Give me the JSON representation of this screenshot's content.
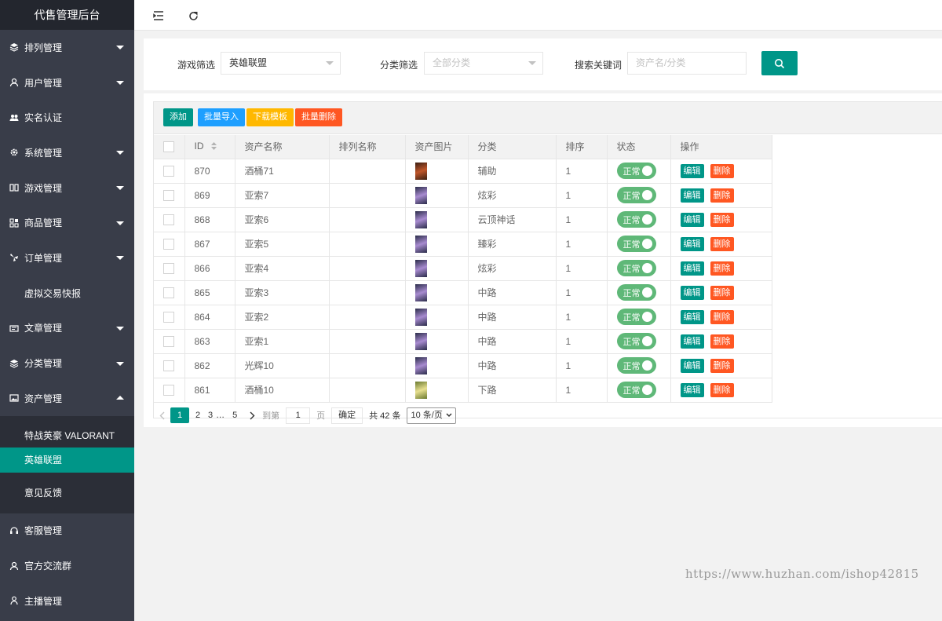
{
  "app": {
    "title": "代售管理后台"
  },
  "sidebar": {
    "items": [
      {
        "label": "排列管理",
        "icon": "layers-icon"
      },
      {
        "label": "用户管理",
        "icon": "user-icon"
      },
      {
        "label": "实名认证",
        "icon": "users-icon"
      },
      {
        "label": "系统管理",
        "icon": "gear-icon"
      },
      {
        "label": "游戏管理",
        "icon": "columns-icon"
      },
      {
        "label": "商品管理",
        "icon": "grid-icon"
      },
      {
        "label": "订单管理",
        "icon": "fan-icon"
      },
      {
        "label": "虚拟交易快报",
        "icon": ""
      },
      {
        "label": "文章管理",
        "icon": "article-icon"
      },
      {
        "label": "分类管理",
        "icon": "layers-icon"
      },
      {
        "label": "资产管理",
        "icon": "image-icon"
      }
    ],
    "asset_sub": [
      {
        "label": "特战英豪 VALORANT"
      },
      {
        "label": "英雄联盟"
      },
      {
        "label": "意见反馈"
      }
    ],
    "bottom_items": [
      {
        "label": "客服管理",
        "icon": "headset-icon"
      },
      {
        "label": "官方交流群",
        "icon": "user-icon"
      },
      {
        "label": "主播管理",
        "icon": "person-icon"
      }
    ]
  },
  "filters": {
    "game_label": "游戏筛选",
    "game_value": "英雄联盟",
    "category_label": "分类筛选",
    "category_placeholder": "全部分类",
    "keyword_label": "搜索关键词",
    "keyword_placeholder": "资产名/分类"
  },
  "toolbar": {
    "add": "添加",
    "import": "批量导入",
    "download": "下载模板",
    "batch_delete": "批量删除"
  },
  "table": {
    "headers": {
      "id": "ID",
      "name": "资产名称",
      "rank_name": "排列名称",
      "image": "资产图片",
      "category": "分类",
      "sort": "排序",
      "status": "状态",
      "ops": "操作"
    },
    "rows": [
      {
        "id": "870",
        "name": "酒桶71",
        "rank_name": "",
        "category": "辅助",
        "sort": "1",
        "status": "正常"
      },
      {
        "id": "869",
        "name": "亚索7",
        "rank_name": "",
        "category": "炫彩",
        "sort": "1",
        "status": "正常"
      },
      {
        "id": "868",
        "name": "亚索6",
        "rank_name": "",
        "category": "云顶神话",
        "sort": "1",
        "status": "正常"
      },
      {
        "id": "867",
        "name": "亚索5",
        "rank_name": "",
        "category": "臻彩",
        "sort": "1",
        "status": "正常"
      },
      {
        "id": "866",
        "name": "亚索4",
        "rank_name": "",
        "category": "炫彩",
        "sort": "1",
        "status": "正常"
      },
      {
        "id": "865",
        "name": "亚索3",
        "rank_name": "",
        "category": "中路",
        "sort": "1",
        "status": "正常"
      },
      {
        "id": "864",
        "name": "亚索2",
        "rank_name": "",
        "category": "中路",
        "sort": "1",
        "status": "正常"
      },
      {
        "id": "863",
        "name": "亚索1",
        "rank_name": "",
        "category": "中路",
        "sort": "1",
        "status": "正常"
      },
      {
        "id": "862",
        "name": "光辉10",
        "rank_name": "",
        "category": "中路",
        "sort": "1",
        "status": "正常"
      },
      {
        "id": "861",
        "name": "酒桶10",
        "rank_name": "",
        "category": "下路",
        "sort": "1",
        "status": "正常"
      }
    ],
    "edit_label": "编辑",
    "delete_label": "删除"
  },
  "pager": {
    "pages": [
      "1",
      "2",
      "3",
      "…",
      "5"
    ],
    "goto_prefix": "到第",
    "goto_value": "1",
    "goto_suffix": "页",
    "confirm": "确定",
    "total": "共 42 条",
    "page_size": "10 条/页"
  },
  "watermark": "https://www.huzhan.com/ishop42815",
  "colors": {
    "primary": "#009688",
    "blue": "#1e9fff",
    "orange": "#ffb800",
    "red": "#ff5722",
    "sidebar": "#393d49",
    "switch": "#5fb878"
  }
}
